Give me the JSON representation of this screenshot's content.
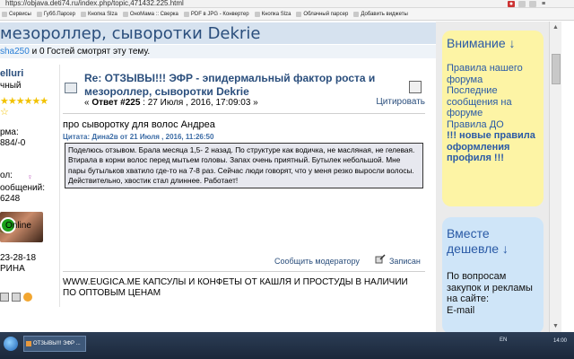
{
  "browser": {
    "url": "https://objava.deti74.ru/index.php/topic,471432.225.html",
    "bookmarks": [
      "Сервисы",
      "Губб.Парсер",
      "Кнопка Slza",
      "ОноМама :: Сверка",
      "PDF в JPG - Конвертер",
      "Кнопка Slza",
      "Облачный парсер",
      "Добавить виджеты"
    ]
  },
  "page": {
    "title_partial": "мезороллер, сыворотки Dekrie",
    "guests_user": "sha250",
    "guests_text": " и 0 Гостей смотрят эту тему."
  },
  "user": {
    "name": "elluri",
    "status": "чный",
    "karma_label": "рма:",
    "karma_value": "884/-0",
    "gender_label": "ол:",
    "posts_label": "ообщений:",
    "posts_value": "6248",
    "online": "Online",
    "date_partial": "23-28-18",
    "name_partial": "РИНА"
  },
  "post": {
    "title": "Re: ОТЗЫВЫ!!! ЭФР - эпидермальный фактор роста и мезороллер, сыворотки Dekrie",
    "meta_prefix": "« ",
    "meta_reply": "Ответ #225",
    "meta_date": " : 27 Июля , 2016, 17:09:03 »",
    "quote_button": "Цитировать",
    "intro": "про сыворотку для волос Андреа",
    "quote_header": "Цитата: Дина2в от 21 Июля , 2016, 11:26:50",
    "quote_text": "Поделюсь отзывом. Брала месяца 1,5- 2 назад. По структуре как водичка, не масляная, не гелевая. Втирала в корни волос перед мытьем головы. Запах очень приятный. Бутылек небольшой. Мне пары бутыльков хватило где-то на 7-8 раз. Сейчас люди говорят, что у меня резко выросли волосы. Действительно, хвостик стал длиннее. Работает!",
    "report_link": "Сообщить модератору",
    "recorded_link": "Записан",
    "signature": "WWW.EUGICA.ME КАПСУЛЫ И КОНФЕТЫ ОТ КАШЛЯ И ПРОСТУДЫ В НАЛИЧИИ ПО ОПТОВЫМ ЦЕНАМ"
  },
  "sidebar": {
    "box1_header": "Внимание ↓",
    "box1_links": [
      "Правила нашего форума",
      "Последние сообщения на форуме",
      "Правила ДО"
    ],
    "box1_hot": "!!! новые правила оформления профиля !!!",
    "box2_header": "Вместе дешевле ↓",
    "box2_text": "По вопросам закупок и рекламы на сайте:",
    "box2_email": "E-mail"
  },
  "taskbar": {
    "task_label": "ОТЗЫВЫ!!! ЭФР ...",
    "lang": "EN",
    "clock": "14:00"
  },
  "colors": {
    "title_blue": "#2a4e7c",
    "header_bg": "#d6e2ef",
    "notice_yellow": "#fdf4a5",
    "promo_blue": "#cfe5f8",
    "quote_bg": "#e7e8ef"
  }
}
